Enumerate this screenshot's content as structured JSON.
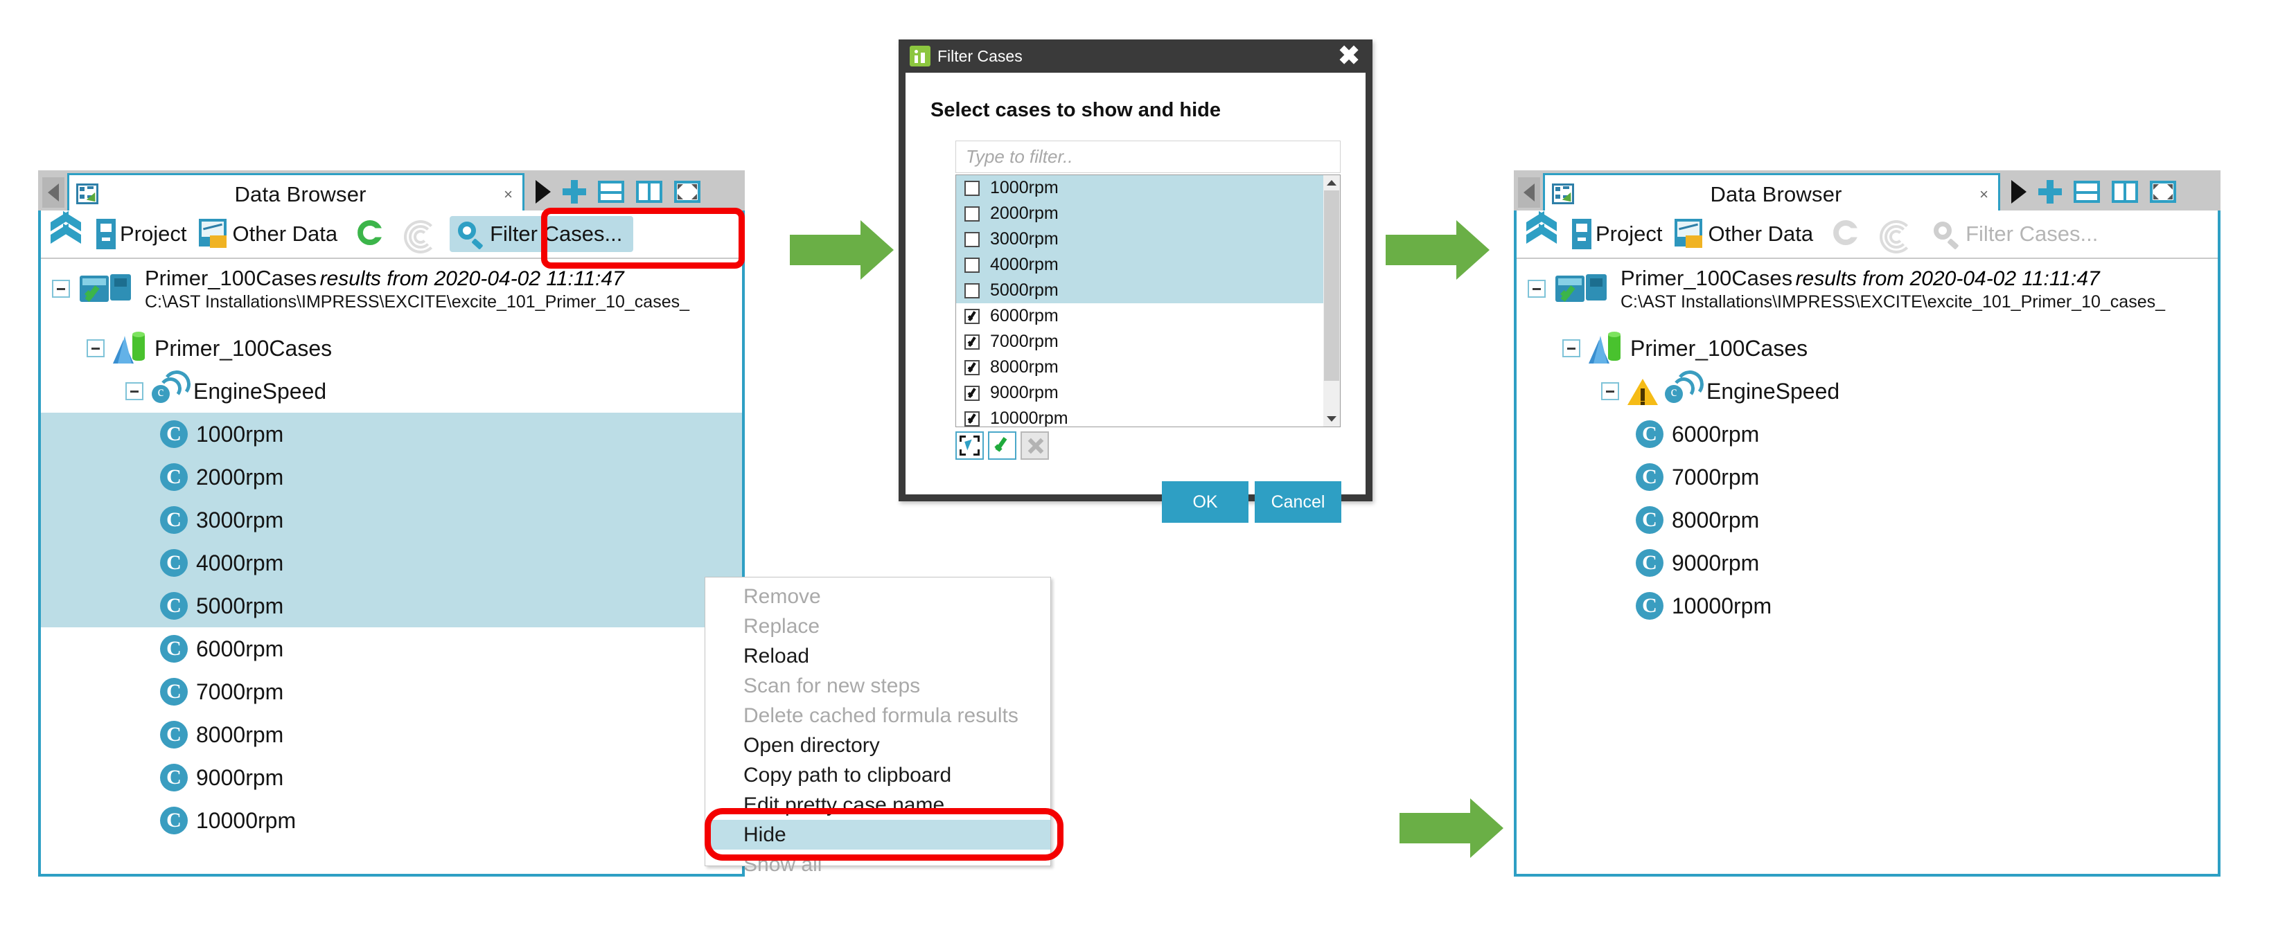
{
  "left_panel": {
    "tab_title": "Data Browser",
    "tab_close": "×",
    "toolbar": {
      "project_label": "Project",
      "other_data_label": "Other Data",
      "filter_cases_label": "Filter Cases..."
    },
    "tree": {
      "root_name": "Primer_100Cases",
      "root_suffix": "results from 2020-04-02 11:11:47",
      "root_path": "C:\\AST Installations\\IMPRESS\\EXCITE\\excite_101_Primer_10_cases_",
      "level1": "Primer_100Cases",
      "level2": "EngineSpeed",
      "cases": [
        {
          "label": "1000rpm",
          "selected": true
        },
        {
          "label": "2000rpm",
          "selected": true
        },
        {
          "label": "3000rpm",
          "selected": true
        },
        {
          "label": "4000rpm",
          "selected": true
        },
        {
          "label": "5000rpm",
          "selected": true
        },
        {
          "label": "6000rpm",
          "selected": false
        },
        {
          "label": "7000rpm",
          "selected": false
        },
        {
          "label": "8000rpm",
          "selected": false
        },
        {
          "label": "9000rpm",
          "selected": false
        },
        {
          "label": "10000rpm",
          "selected": false
        }
      ]
    }
  },
  "context_menu": {
    "items": [
      {
        "label": "Remove",
        "disabled": true,
        "highlighted": false
      },
      {
        "label": "Replace",
        "disabled": true,
        "highlighted": false
      },
      {
        "label": "Reload",
        "disabled": false,
        "highlighted": false
      },
      {
        "label": "Scan for new steps",
        "disabled": true,
        "highlighted": false
      },
      {
        "label": "Delete cached formula results",
        "disabled": true,
        "highlighted": false
      },
      {
        "label": "Open directory",
        "disabled": false,
        "highlighted": false
      },
      {
        "label": "Copy path to clipboard",
        "disabled": false,
        "highlighted": false
      },
      {
        "label": "Edit pretty case name",
        "disabled": false,
        "highlighted": false
      },
      {
        "label": "Hide",
        "disabled": false,
        "highlighted": true
      },
      {
        "label": "Show all",
        "disabled": true,
        "highlighted": false
      }
    ]
  },
  "dialog": {
    "title": "Filter Cases",
    "close_label": "✖",
    "heading": "Select cases to show and hide",
    "filter_placeholder": "Type to filter..",
    "ok_label": "OK",
    "cancel_label": "Cancel",
    "list": [
      {
        "label": "1000rpm",
        "checked": false,
        "selected": true
      },
      {
        "label": "2000rpm",
        "checked": false,
        "selected": true
      },
      {
        "label": "3000rpm",
        "checked": false,
        "selected": true
      },
      {
        "label": "4000rpm",
        "checked": false,
        "selected": true
      },
      {
        "label": "5000rpm",
        "checked": false,
        "selected": true
      },
      {
        "label": "6000rpm",
        "checked": true,
        "selected": false
      },
      {
        "label": "7000rpm",
        "checked": true,
        "selected": false
      },
      {
        "label": "8000rpm",
        "checked": true,
        "selected": false
      },
      {
        "label": "9000rpm",
        "checked": true,
        "selected": false
      },
      {
        "label": "10000rpm",
        "checked": true,
        "selected": false
      }
    ]
  },
  "right_panel": {
    "tab_title": "Data Browser",
    "tab_close": "×",
    "toolbar": {
      "project_label": "Project",
      "other_data_label": "Other Data",
      "filter_cases_label": "Filter Cases..."
    },
    "tree": {
      "root_name": "Primer_100Cases",
      "root_suffix": "results from 2020-04-02 11:11:47",
      "root_path": "C:\\AST Installations\\IMPRESS\\EXCITE\\excite_101_Primer_10_cases_",
      "level1": "Primer_100Cases",
      "level2": "EngineSpeed",
      "cases": [
        {
          "label": "6000rpm"
        },
        {
          "label": "7000rpm"
        },
        {
          "label": "8000rpm"
        },
        {
          "label": "9000rpm"
        },
        {
          "label": "10000rpm"
        }
      ]
    }
  },
  "colors": {
    "accent": "#2e9fc4",
    "selection": "#bcdde6",
    "highlight_box": "#f40000",
    "arrow_green": "#6aaf46",
    "dialog_chrome": "#3a3a3a"
  }
}
